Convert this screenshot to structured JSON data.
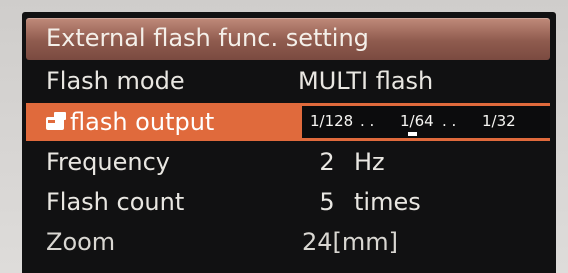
{
  "menu": {
    "title": "External flash func. setting",
    "rows": [
      {
        "label": "Flash mode",
        "value": "MULTI  flash"
      },
      {
        "label": "flash output",
        "ratio": {
          "a": "1/128",
          "sep1": ". . ",
          "b": "1/64",
          "sep2": ". . ",
          "c": "1/32"
        },
        "selected": true
      },
      {
        "label": "Frequency",
        "number": "2",
        "unit": "Hz"
      },
      {
        "label": "Flash count",
        "number": "5",
        "unit": "times"
      },
      {
        "label": "Zoom",
        "value": "24[mm]"
      }
    ]
  },
  "colors": {
    "title_bar": "#8f5b4e",
    "selected_row": "#e06a3c",
    "screen_bg": "#111112"
  },
  "icons": {
    "selected_row_icon": "flash-output-camera-icon"
  }
}
